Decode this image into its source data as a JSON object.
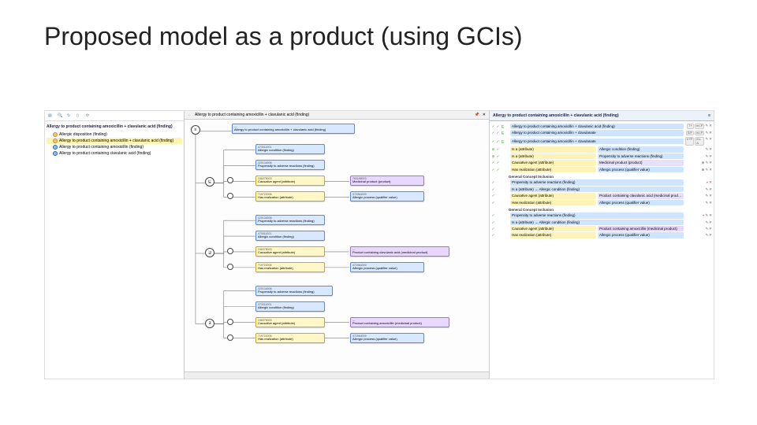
{
  "title": "Proposed model as a product (using GCIs)",
  "left": {
    "header": "Allergy to product containing amoxicillin + clavulanic acid (finding)",
    "items": [
      "Allergic disposition (finding)",
      "Allergy to product containing amoxicillin + clavulanic acid (finding)",
      "Allergy to product containing amoxicillin (finding)",
      "Allergy to product containing clavulanic acid (finding)"
    ]
  },
  "mid": {
    "path": "Allergy to product containing amoxicillin + clavulanic acid (finding)",
    "root": {
      "id": "—",
      "label": "Allergy to product containing amoxicillin + clavulanic acid (finding)"
    },
    "g1": {
      "parent1": {
        "id": "473011001",
        "label": "Allergic condition (finding)"
      },
      "parent2": {
        "id": "420134006",
        "label": "Propensity to adverse reactions (finding)"
      },
      "attr1": {
        "id": "246075003",
        "label": "Causative agent (attribute)"
      },
      "attr2": {
        "id": "719722006",
        "label": "Has realization (attribute)"
      },
      "val1": {
        "id": "763158003",
        "label": "Medicinal product (product)"
      },
      "val2": {
        "id": "472964009",
        "label": "Allergic process (qualifier value)"
      }
    },
    "g2": {
      "parent1": {
        "id": "420134006",
        "label": "Propensity to adverse reactions (finding)"
      },
      "parent2": {
        "id": "473011001",
        "label": "Allergic condition (finding)"
      },
      "attr1": {
        "id": "246075003",
        "label": "Causative agent (attribute)"
      },
      "attr2": {
        "id": "719722006",
        "label": "Has realization (attribute)"
      },
      "val1": {
        "id": "—",
        "label": "Product containing clavulanic acid (medicinal product)"
      },
      "val2": {
        "id": "472964009",
        "label": "Allergic process (qualifier value)"
      }
    },
    "g3": {
      "parent1": {
        "id": "420134006",
        "label": "Propensity to adverse reactions (finding)"
      },
      "parent2": {
        "id": "473011001",
        "label": "Allergic condition (finding)"
      },
      "attr1": {
        "id": "246075003",
        "label": "Causative agent (attribute)"
      },
      "attr2": {
        "id": "719722006",
        "label": "Has realization (attribute)"
      },
      "val1": {
        "id": "—",
        "label": "Product containing amoxicillin (medicinal product)"
      },
      "val2": {
        "id": "472964009",
        "label": "Allergic process (qualifier value)"
      }
    }
  },
  "right": {
    "header": "Allergy to product containing amoxicillin + clavulanic acid (finding)",
    "axioms": [
      {
        "label": "Allergy to product containing amoxicillin + clavulanic acid (finding)",
        "s1": "7+",
        "s2": "en-P"
      },
      {
        "label": "Allergy to product containing amoxicillin + clavulanate",
        "s1": "S/F",
        "s2": "en-P"
      },
      {
        "label": "Allergy to product containing amoxicillin + clavulanate",
        "s1": "e+P",
        "s2": "en-A"
      },
      {
        "label": "Is a (attribute)",
        "val": "Allergic condition (finding)"
      },
      {
        "label": "Is a (attribute)",
        "val": "Propensity to adverse reactions (finding)"
      },
      {
        "label": "Causative agent (attribute)",
        "val": "Medicinal product (product)"
      },
      {
        "label": "Has realization (attribute)",
        "val": "Allergic process (qualifier value)"
      }
    ],
    "sub1": "General Concept Inclusion",
    "gci1": [
      {
        "label": "Propensity to adverse reactions (finding)"
      },
      {
        "label": "Is a (attribute) → Allergic condition (finding)"
      },
      {
        "label": "Causative agent (attribute)",
        "val": "Product containing clavulanic acid (medicinal product)"
      },
      {
        "label": "Has realization (attribute)",
        "val": "Allergic process (qualifier value)"
      }
    ],
    "sub2": "General Concept Inclusion",
    "gci2": [
      {
        "label": "Propensity to adverse reactions (finding)"
      },
      {
        "label": "Is a (attribute) → Allergic condition (finding)"
      },
      {
        "label": "Causative agent (attribute)",
        "val": "Product containing amoxicillin (medicinal product)"
      },
      {
        "label": "Has realization (attribute)",
        "val": "Allergic process (qualifier value)"
      }
    ]
  }
}
